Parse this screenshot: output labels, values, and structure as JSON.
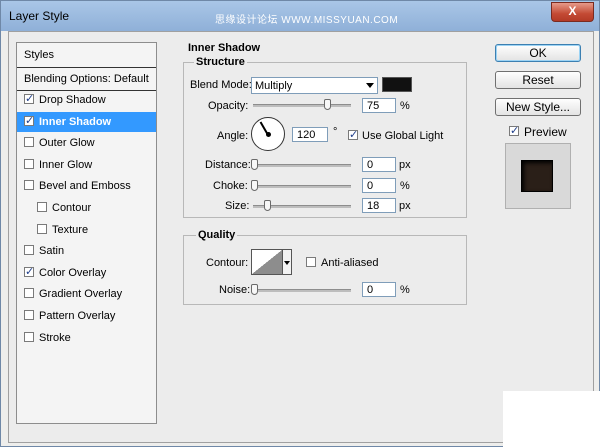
{
  "window": {
    "title": "Layer Style",
    "watermark": "思缘设计论坛 WWW.MISSYUAN.COM",
    "close_label": "X"
  },
  "styles_panel": {
    "header": "Styles",
    "blending_options": "Blending Options: Default",
    "effects": [
      {
        "label": "Drop Shadow",
        "checked": true,
        "selected": false,
        "indent": false
      },
      {
        "label": "Inner Shadow",
        "checked": true,
        "selected": true,
        "indent": false
      },
      {
        "label": "Outer Glow",
        "checked": false,
        "selected": false,
        "indent": false
      },
      {
        "label": "Inner Glow",
        "checked": false,
        "selected": false,
        "indent": false
      },
      {
        "label": "Bevel and Emboss",
        "checked": false,
        "selected": false,
        "indent": false
      },
      {
        "label": "Contour",
        "checked": false,
        "selected": false,
        "indent": true
      },
      {
        "label": "Texture",
        "checked": false,
        "selected": false,
        "indent": true
      },
      {
        "label": "Satin",
        "checked": false,
        "selected": false,
        "indent": false
      },
      {
        "label": "Color Overlay",
        "checked": true,
        "selected": false,
        "indent": false
      },
      {
        "label": "Gradient Overlay",
        "checked": false,
        "selected": false,
        "indent": false
      },
      {
        "label": "Pattern Overlay",
        "checked": false,
        "selected": false,
        "indent": false
      },
      {
        "label": "Stroke",
        "checked": false,
        "selected": false,
        "indent": false
      }
    ]
  },
  "inner_shadow": {
    "title": "Inner Shadow",
    "structure": {
      "title": "Structure",
      "blend_mode_label": "Blend Mode:",
      "blend_mode_value": "Multiply",
      "shadow_color": "#111111",
      "opacity_label": "Opacity:",
      "opacity_value": "75",
      "opacity_unit": "%",
      "angle_label": "Angle:",
      "angle_value": "120",
      "angle_unit": "°",
      "use_global_light_label": "Use Global Light",
      "use_global_light_checked": true,
      "distance_label": "Distance:",
      "distance_value": "0",
      "distance_unit": "px",
      "choke_label": "Choke:",
      "choke_value": "0",
      "choke_unit": "%",
      "size_label": "Size:",
      "size_value": "18",
      "size_unit": "px"
    },
    "quality": {
      "title": "Quality",
      "contour_label": "Contour:",
      "anti_aliased_label": "Anti-aliased",
      "anti_aliased_checked": false,
      "noise_label": "Noise:",
      "noise_value": "0",
      "noise_unit": "%"
    }
  },
  "buttons": {
    "ok": "OK",
    "reset": "Reset",
    "new_style": "New Style...",
    "preview_label": "Preview",
    "preview_checked": true
  },
  "colors": {
    "selection": "#3399ff",
    "preview_swatch": "#2a1f18"
  },
  "icons": {
    "close": "close-icon",
    "dropdown": "chevron-down-icon"
  }
}
